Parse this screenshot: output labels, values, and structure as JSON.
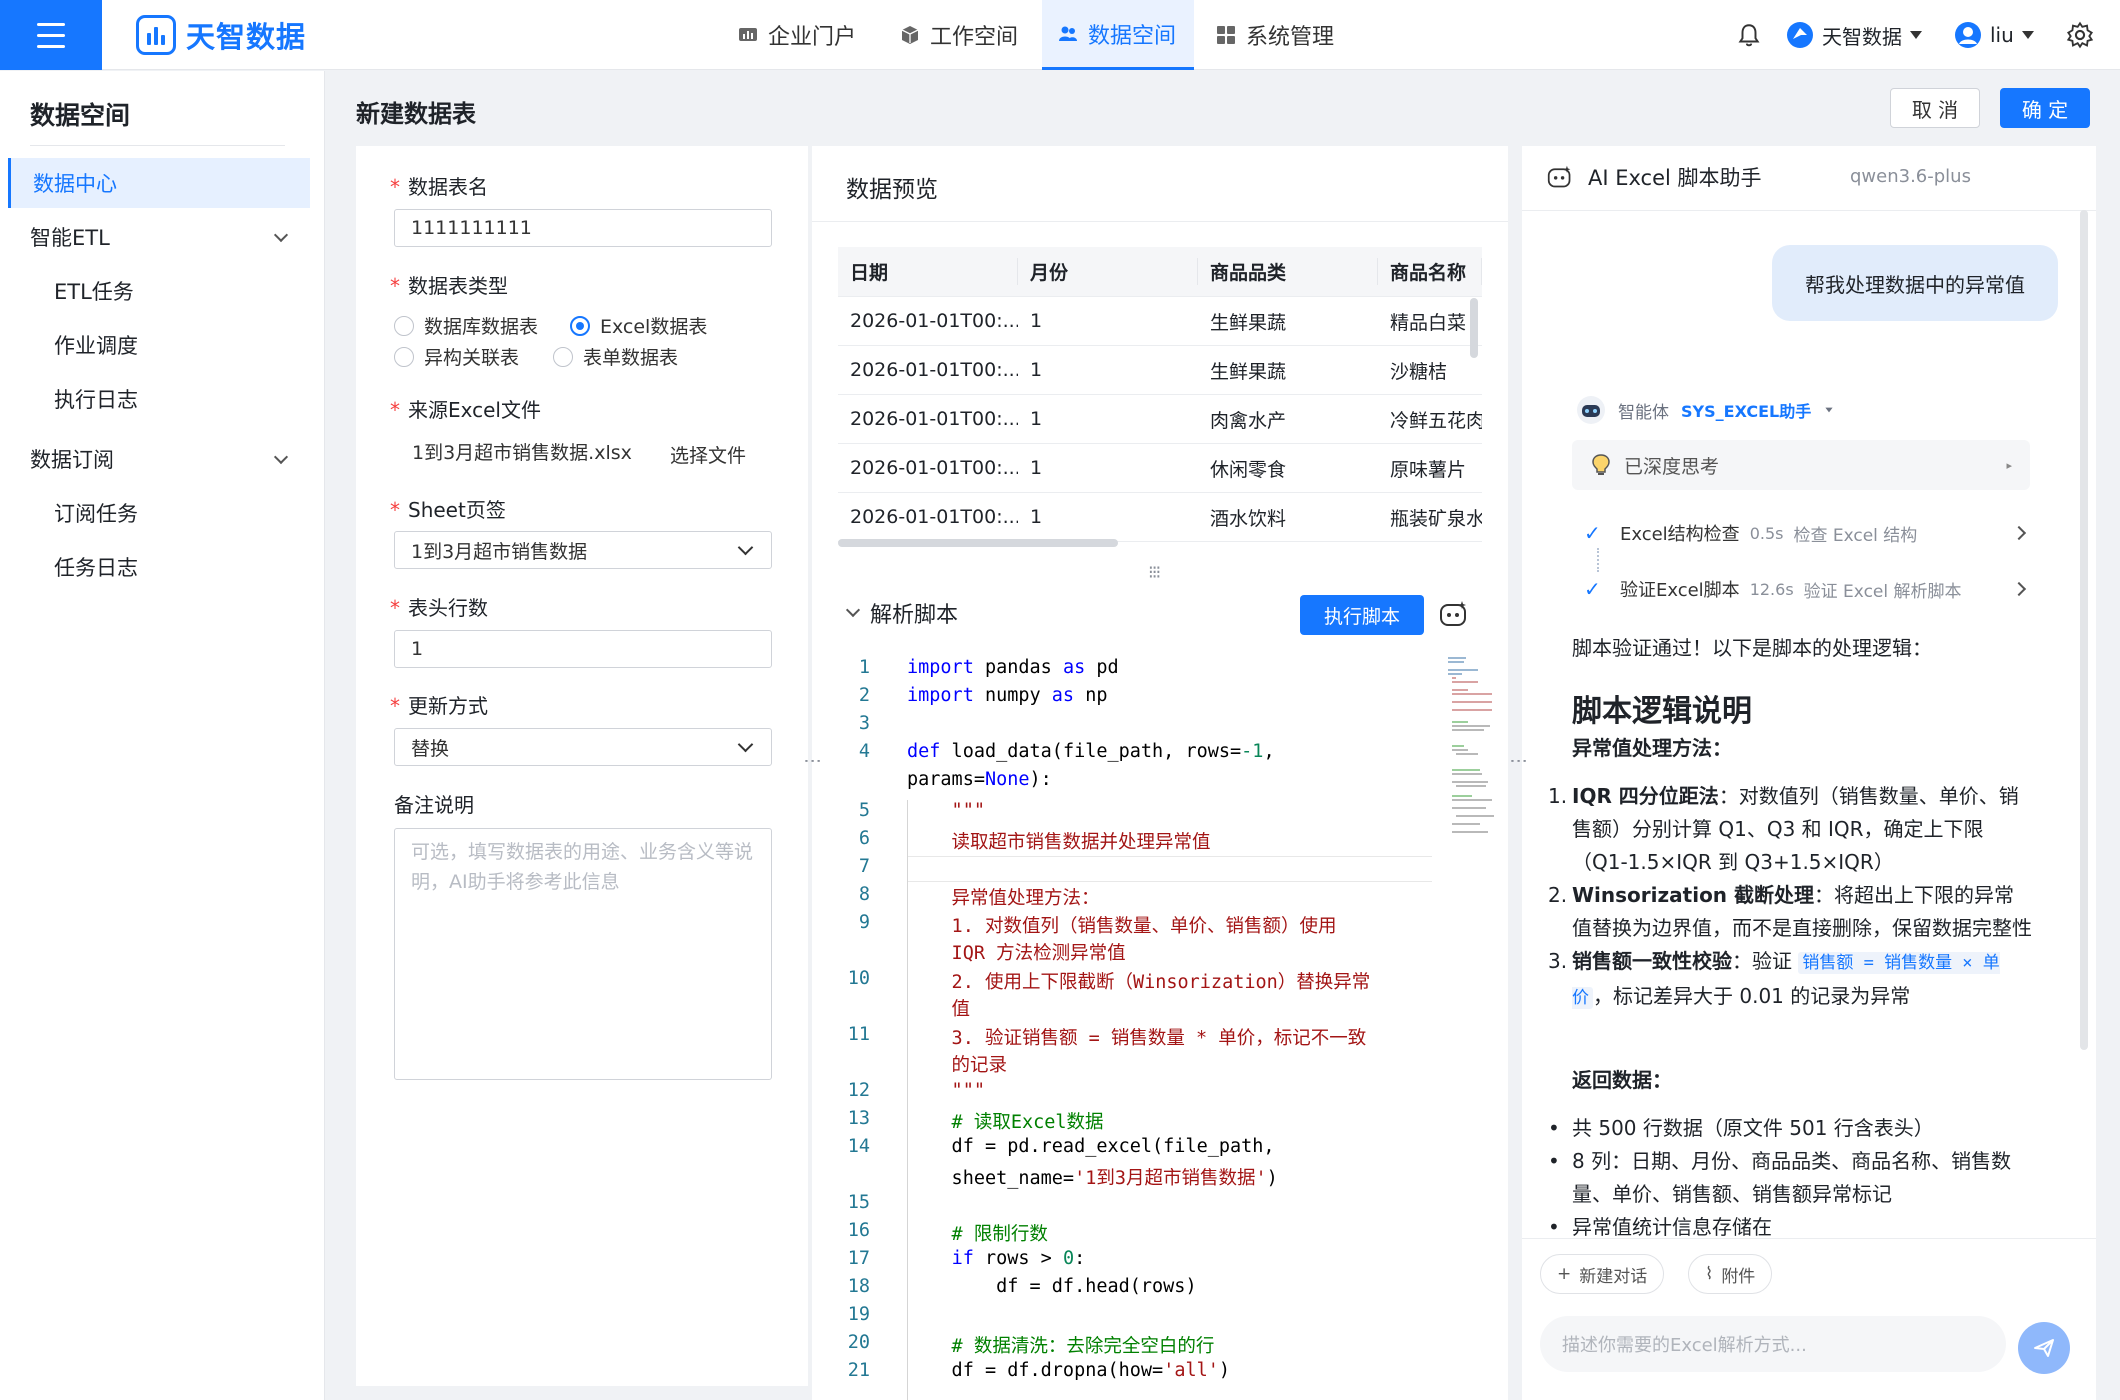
{
  "header": {
    "brand": "天智数据",
    "nav": [
      {
        "label": "企业门户",
        "icon": "chart-icon"
      },
      {
        "label": "工作空间",
        "icon": "cube-icon"
      },
      {
        "label": "数据空间",
        "icon": "users-icon",
        "active": true
      },
      {
        "label": "系统管理",
        "icon": "grid-icon"
      }
    ],
    "org": "天智数据",
    "user": "liu"
  },
  "sidebar": {
    "title": "数据空间",
    "items": [
      {
        "label": "数据中心",
        "active": true
      },
      {
        "label": "智能ETL",
        "expandable": true
      },
      {
        "label": "ETL任务",
        "sub": true
      },
      {
        "label": "作业调度",
        "sub": true
      },
      {
        "label": "执行日志",
        "sub": true
      },
      {
        "label": "数据订阅",
        "expandable": true
      },
      {
        "label": "订阅任务",
        "sub": true
      },
      {
        "label": "任务日志",
        "sub": true
      }
    ]
  },
  "page": {
    "title": "新建数据表",
    "cancel_label": "取 消",
    "ok_label": "确 定"
  },
  "form": {
    "name_label": "数据表名",
    "name_value": "1111111111",
    "type_label": "数据表类型",
    "types": [
      "数据库数据表",
      "Excel数据表",
      "异构关联表",
      "表单数据表"
    ],
    "type_selected": "Excel数据表",
    "file_label": "来源Excel文件",
    "file_value": "1到3月超市销售数据.xlsx",
    "file_button": "选择文件",
    "sheet_label": "Sheet页签",
    "sheet_value": "1到3月超市销售数据",
    "header_rows_label": "表头行数",
    "header_rows_value": "1",
    "update_label": "更新方式",
    "update_value": "替换",
    "remark_label": "备注说明",
    "remark_placeholder": "可选，填写数据表的用途、业务含义等说明，AI助手将参考此信息"
  },
  "preview": {
    "title": "数据预览",
    "columns": [
      "日期",
      "月份",
      "商品品类",
      "商品名称"
    ],
    "rows": [
      [
        "2026-01-01T00:...",
        "1",
        "生鲜果蔬",
        "精品白菜"
      ],
      [
        "2026-01-01T00:...",
        "1",
        "生鲜果蔬",
        "沙糖桔"
      ],
      [
        "2026-01-01T00:...",
        "1",
        "肉禽水产",
        "冷鲜五花肉"
      ],
      [
        "2026-01-01T00:...",
        "1",
        "休闲零食",
        "原味薯片"
      ],
      [
        "2026-01-01T00:...",
        "1",
        "酒水饮料",
        "瓶装矿泉水"
      ]
    ]
  },
  "script": {
    "title": "解析脚本",
    "run_label": "执行脚本"
  },
  "ai": {
    "title": "AI Excel 脚本助手",
    "model": "qwen3.6-plus",
    "user_message": "帮我处理数据中的异常值",
    "agent_label": "智能体",
    "agent_tag": "SYS_EXCEL助手",
    "thinking": "已深度思考",
    "steps": [
      {
        "name": "Excel结构检查",
        "time": "0.5s",
        "desc": "检查 Excel 结构"
      },
      {
        "name": "验证Excel脚本",
        "time": "12.6s",
        "desc": "验证 Excel 解析脚本"
      }
    ],
    "intro": "脚本验证通过！以下是脚本的处理逻辑：",
    "heading": "脚本逻辑说明",
    "sub1": "异常值处理方法：",
    "li1_b": "IQR 四分位距法",
    "li1": "：对数值列（销售数量、单价、销售额）分别计算 Q1、Q3 和 IQR，确定上下限（Q1-1.5×IQR 到 Q3+1.5×IQR）",
    "li2_b": "Winsorization 截断处理",
    "li2": "：将超出上下限的异常值替换为边界值，而不是直接删除，保留数据完整性",
    "li3_b": "销售额一致性校验",
    "li3_a": "：验证 ",
    "li3_code": "销售额 = 销售数量 × 单价",
    "li3_c": "，标记差异大于 0.01 的记录为异常",
    "sub2": "返回数据：",
    "b1": "共 500 行数据（原文件 501 行含表头）",
    "b2": "8 列：日期、月份、商品品类、商品名称、销售数量、单价、销售额、销售额异常标记",
    "b3": "异常值统计信息存储在",
    "new_chat": "新建对话",
    "attach": "附件",
    "input_placeholder": "描述你需要的Excel解析方式..."
  }
}
